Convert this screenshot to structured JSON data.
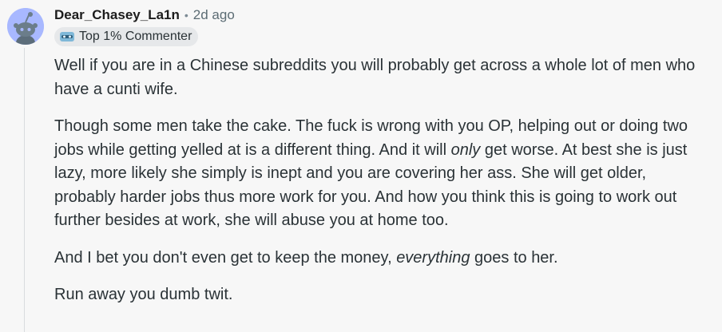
{
  "comment": {
    "author": "Dear_Chasey_La1n",
    "separator": "•",
    "time": "2d ago",
    "flair": "Top 1% Commenter",
    "paragraphs": {
      "p1": "Well if you are in a Chinese subreddits you will probably get across a whole lot of men who have a cunti wife.",
      "p2_part1": "Though some men take the cake. The fuck is wrong with you OP, helping out or doing two jobs while getting yelled at is a different thing. And it will ",
      "p2_emph": "only",
      "p2_part2": " get worse. At best she is just lazy, more likely she simply is inept and you are covering her ass. She will get older, probably harder jobs thus more work for you. And how you think this is going to work out further besides at work, she will abuse you at home too.",
      "p3_part1": "And I bet you don't even get to keep the money, ",
      "p3_emph": "everything",
      "p3_part2": " goes to her.",
      "p4": "Run away you dumb twit."
    }
  },
  "icons": {
    "avatar": "snoo-avatar-icon",
    "flair": "top-commenter-badge-icon"
  },
  "colors": {
    "background": "#f7f7f7",
    "avatar_bg": "#a8b8ff",
    "flair_bg": "#e6e8ea",
    "text": "#2a3236",
    "meta": "#5c6c74"
  }
}
